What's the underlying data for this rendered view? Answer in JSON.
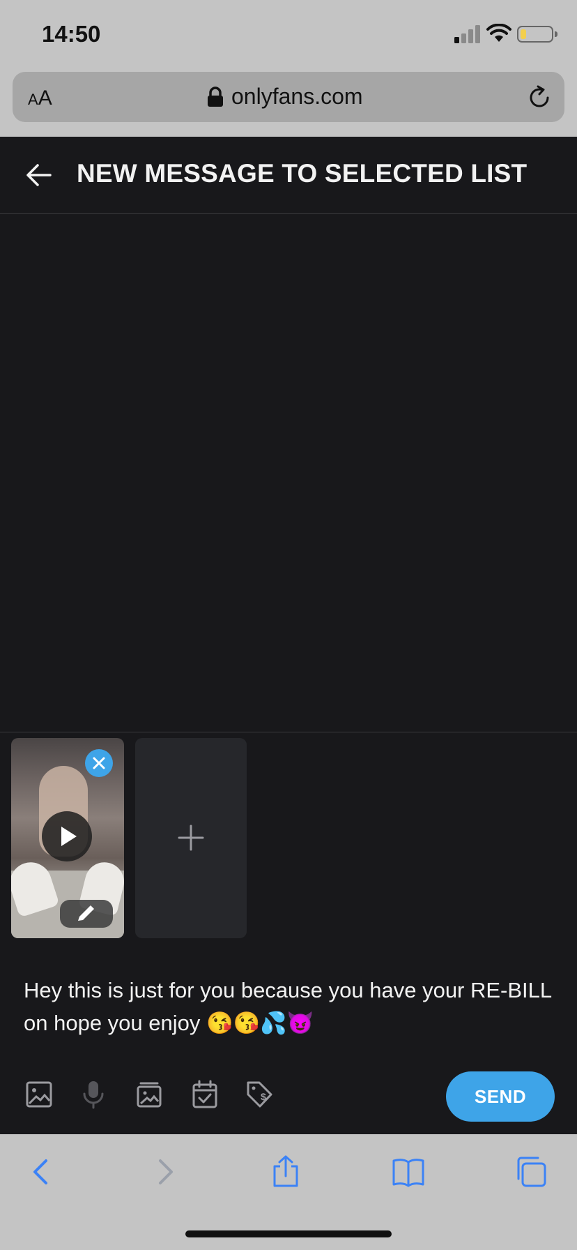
{
  "status_bar": {
    "time": "14:50"
  },
  "browser": {
    "text_size_label": "AA",
    "url": "onlyfans.com"
  },
  "header": {
    "title": "NEW MESSAGE TO SELECTED LIST"
  },
  "composer": {
    "message": "Hey this is just for you because you have your RE-BILL on hope you enjoy 😘😘💦😈",
    "send_label": "SEND"
  },
  "colors": {
    "accent": "#3ea4e8",
    "background": "#18181b",
    "browser_chrome": "#c4c4c4",
    "ios_blue": "#3b82f6"
  },
  "icons": {
    "toolbar": [
      "image-icon",
      "microphone-icon",
      "vault-icon",
      "schedule-icon",
      "price-tag-icon"
    ],
    "browser_nav": [
      "back-icon",
      "forward-icon",
      "share-icon",
      "bookmarks-icon",
      "tabs-icon"
    ]
  }
}
